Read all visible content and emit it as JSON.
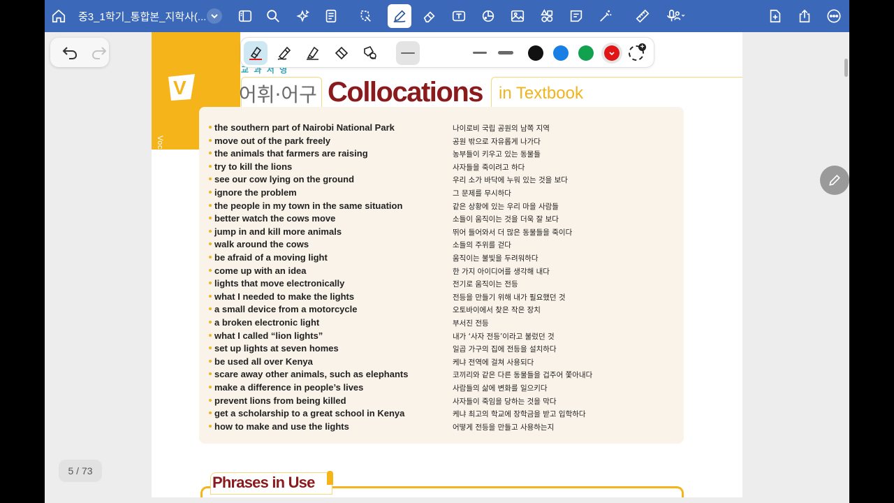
{
  "app": {
    "doc_title": "중3_1학기_통합본_지학사(...",
    "page_counter": "5 / 73"
  },
  "toolbar_icons": [
    "home-icon",
    "chevron-down-icon",
    "sidebar-icon",
    "search-icon",
    "bookmark-sparkle-icon",
    "page-icon",
    "lasso-icon",
    "pen-icon",
    "eraser-icon",
    "textbox-icon",
    "shapes-icon",
    "image-icon",
    "elements-icon",
    "sticky-note-icon",
    "magic-wand-icon",
    "ruler-icon",
    "microphone-icon",
    "add-page-icon",
    "share-icon",
    "more-icon"
  ],
  "pen_toolbar": {
    "tools": [
      "fountain-pen",
      "ballpoint-pen",
      "highlighter",
      "eraser",
      "lasso"
    ],
    "colors": [
      "#111111",
      "#1a7fe5",
      "#12a14f",
      "#e01515"
    ],
    "selected_color": "#e01515"
  },
  "page": {
    "textbook_label": "교 과 서 영",
    "vocab_label": "Vocabulary",
    "v_badge": "V",
    "korean_heading": "어휘·어구",
    "title": "Collocations",
    "subtitle": "in Textbook",
    "rows": [
      {
        "en": "the southern part of Nairobi National Park",
        "ko": "나이로비 국립 공원의 남쪽 지역"
      },
      {
        "en": "move out of the park freely",
        "ko": "공원 밖으로 자유롭게 나가다"
      },
      {
        "en": "the animals that farmers are raising",
        "ko": "농부들이 키우고 있는 동물들"
      },
      {
        "en": "try to kill the lions",
        "ko": "사자들을 죽이려고 하다"
      },
      {
        "en": "see our cow lying on the ground",
        "ko": "우리 소가 바닥에 누워 있는 것을 보다"
      },
      {
        "en": "ignore the problem",
        "ko": "그 문제를 무시하다"
      },
      {
        "en": "the people in my town in the same situation",
        "ko": "같은 상황에 있는 우리 마을 사람들"
      },
      {
        "en": "better watch the cows move",
        "ko": "소들이 움직이는 것을 더욱 잘 보다"
      },
      {
        "en": "jump in and kill more animals",
        "ko": "뛰어 들어와서 더 많은 동물들을 죽이다"
      },
      {
        "en": "walk around the cows",
        "ko": "소들의 주위를 걷다"
      },
      {
        "en": "be afraid of a moving light",
        "ko": "움직이는 불빛을 두려워하다"
      },
      {
        "en": "come up with an idea",
        "ko": "한 가지 아이디어를 생각해 내다"
      },
      {
        "en": "lights that move electronically",
        "ko": "전기로 움직이는 전등"
      },
      {
        "en": "what I needed to make the lights",
        "ko": "전등을 만들기 위해 내가 필요했던 것"
      },
      {
        "en": "a small device from a motorcycle",
        "ko": "오토바이에서 찾은 작은 장치"
      },
      {
        "en": "a broken electronic light",
        "ko": "부서진 전등"
      },
      {
        "en": "what I called “lion lights”",
        "ko": "내가 ‘사자 전등’이라고 불렀던 것"
      },
      {
        "en": "set up lights at seven homes",
        "ko": "일곱 가구의 집에 전등을 설치하다"
      },
      {
        "en": "be used all over Kenya",
        "ko": "케냐 전역에 걸쳐 사용되다"
      },
      {
        "en": "scare away other animals, such as elephants",
        "ko": "코끼리와 같은 다른 동물들을 겁주어 쫓아내다"
      },
      {
        "en": "make a difference in people’s lives",
        "ko": "사람들의 삶에 변화를 일으키다"
      },
      {
        "en": "prevent lions from being killed",
        "ko": "사자들이 죽임을 당하는 것을 막다"
      },
      {
        "en": "get a scholarship to a great school in Kenya",
        "ko": "케냐 최고의 학교에 장학금을 받고 입학하다"
      },
      {
        "en": "how to make and use the lights",
        "ko": "어떻게 전등을 만들고 사용하는지"
      }
    ],
    "phrases_title": "Phrases in Use"
  }
}
